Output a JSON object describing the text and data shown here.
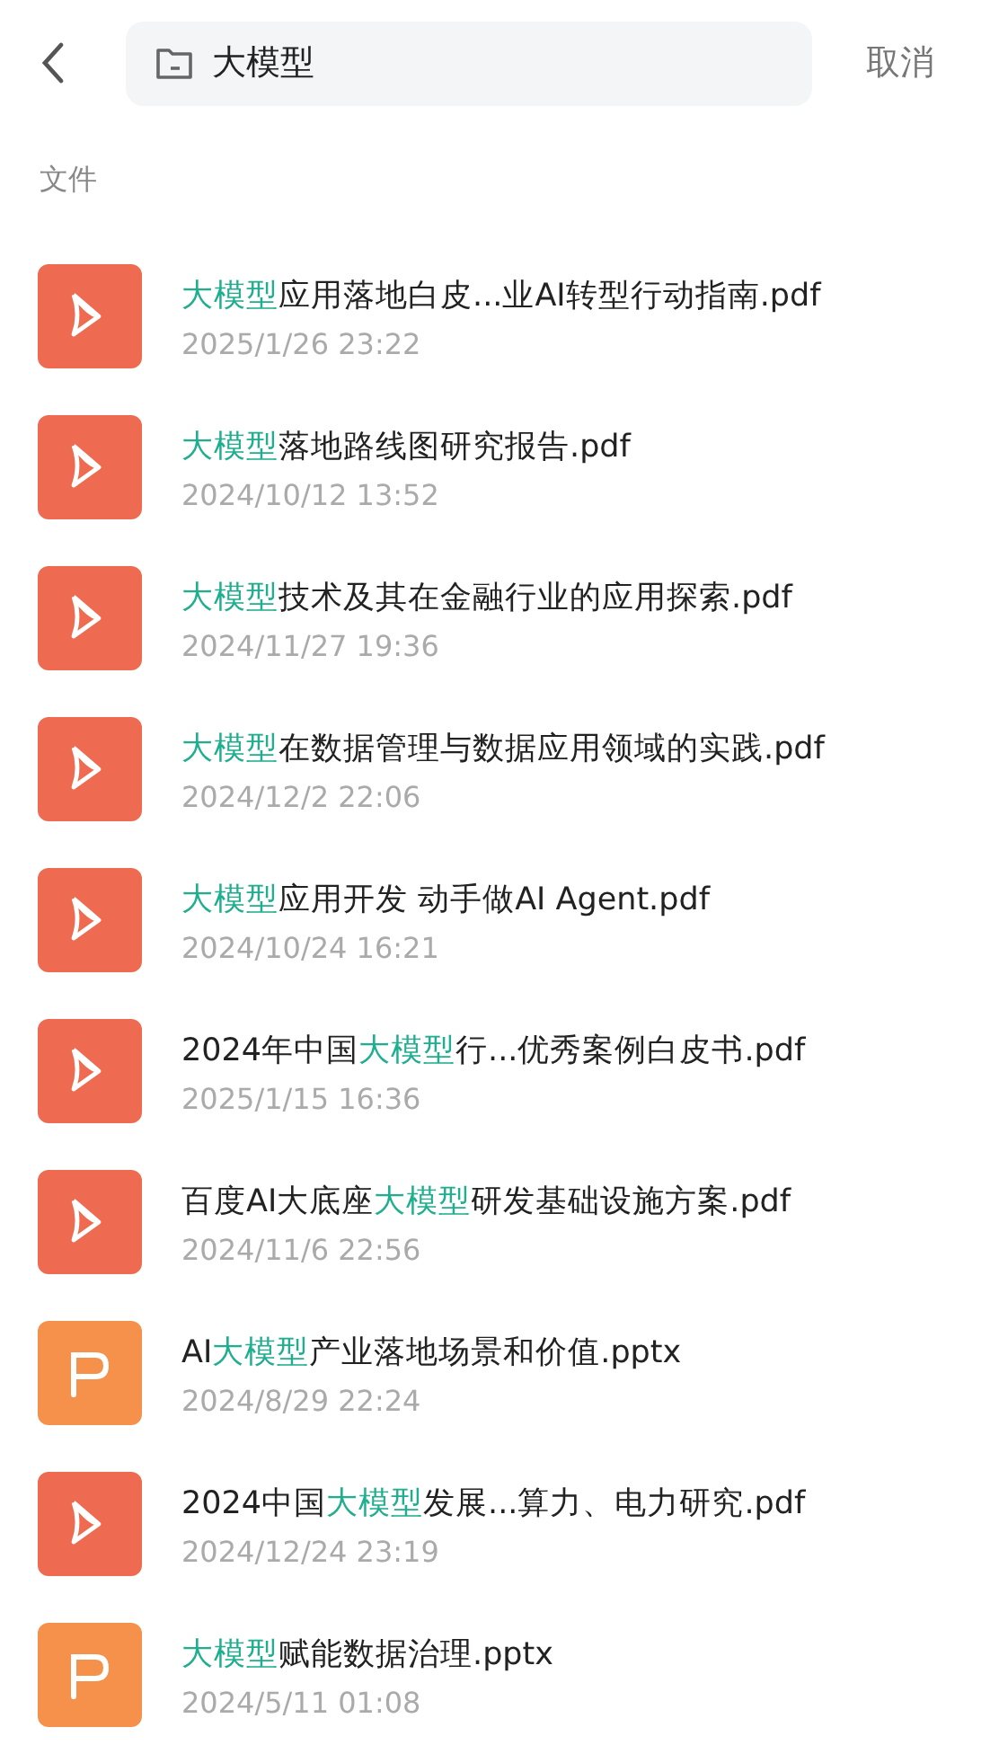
{
  "search": {
    "value": "大模型",
    "cancel": "取消"
  },
  "section_title": "文件",
  "files": [
    {
      "kind": "pdf",
      "name": [
        {
          "text": "大模型",
          "highlight": true
        },
        {
          "text": "应用落地白皮...业AI转型行动指南.pdf",
          "highlight": false
        }
      ],
      "date": "2025/1/26 23:22"
    },
    {
      "kind": "pdf",
      "name": [
        {
          "text": "大模型",
          "highlight": true
        },
        {
          "text": "落地路线图研究报告.pdf",
          "highlight": false
        }
      ],
      "date": "2024/10/12 13:52"
    },
    {
      "kind": "pdf",
      "name": [
        {
          "text": "大模型",
          "highlight": true
        },
        {
          "text": "技术及其在金融行业的应用探索.pdf",
          "highlight": false
        }
      ],
      "date": "2024/11/27 19:36"
    },
    {
      "kind": "pdf",
      "name": [
        {
          "text": "大模型",
          "highlight": true
        },
        {
          "text": "在数据管理与数据应用领域的实践.pdf",
          "highlight": false
        }
      ],
      "date": "2024/12/2 22:06"
    },
    {
      "kind": "pdf",
      "name": [
        {
          "text": "大模型",
          "highlight": true
        },
        {
          "text": "应用开发 动手做AI Agent.pdf",
          "highlight": false
        }
      ],
      "date": "2024/10/24 16:21"
    },
    {
      "kind": "pdf",
      "name": [
        {
          "text": "2024年中国",
          "highlight": false
        },
        {
          "text": "大模型",
          "highlight": true
        },
        {
          "text": "行...优秀案例白皮书.pdf",
          "highlight": false
        }
      ],
      "date": "2025/1/15 16:36"
    },
    {
      "kind": "pdf",
      "name": [
        {
          "text": "百度AI大底座",
          "highlight": false
        },
        {
          "text": "大模型",
          "highlight": true
        },
        {
          "text": "研发基础设施方案.pdf",
          "highlight": false
        }
      ],
      "date": "2024/11/6 22:56"
    },
    {
      "kind": "pptx",
      "name": [
        {
          "text": "AI",
          "highlight": false
        },
        {
          "text": "大模型",
          "highlight": true
        },
        {
          "text": "产业落地场景和价值.pptx",
          "highlight": false
        }
      ],
      "date": "2024/8/29 22:24"
    },
    {
      "kind": "pdf",
      "name": [
        {
          "text": "2024中国",
          "highlight": false
        },
        {
          "text": "大模型",
          "highlight": true
        },
        {
          "text": "发展...算力、电力研究.pdf",
          "highlight": false
        }
      ],
      "date": "2024/12/24 23:19"
    },
    {
      "kind": "pptx",
      "name": [
        {
          "text": "大模型",
          "highlight": true
        },
        {
          "text": "赋能数据治理.pptx",
          "highlight": false
        }
      ],
      "date": "2024/5/11 01:08"
    }
  ]
}
